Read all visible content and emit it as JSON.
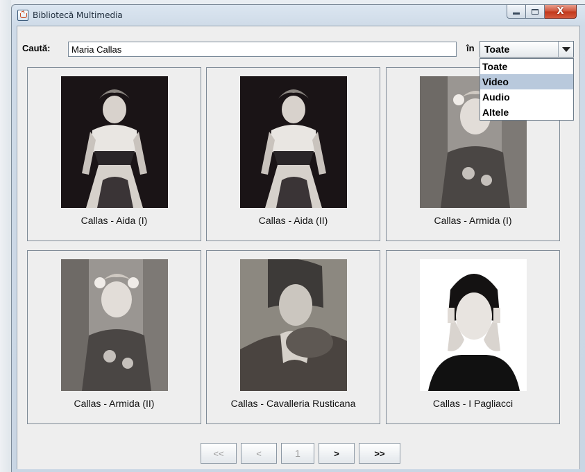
{
  "window": {
    "title": "Bibliotecă Multimedia",
    "close_glyph": "X"
  },
  "search": {
    "label": "Caută:",
    "value": "Maria Callas",
    "in_label": "în"
  },
  "filter": {
    "selected": "Toate",
    "options": [
      "Toate",
      "Video",
      "Audio",
      "Altele"
    ],
    "highlighted_option": "Video"
  },
  "results": [
    {
      "caption": "Callas - Aida (I)",
      "image": "portrait-opera-costume-photo"
    },
    {
      "caption": "Callas - Aida (II)",
      "image": "portrait-opera-costume-photo"
    },
    {
      "caption": "Callas - Armida (I)",
      "image": "portrait-flower-crown-photo"
    },
    {
      "caption": "Callas - Armida (II)",
      "image": "portrait-flower-crown-photo"
    },
    {
      "caption": "Callas - Cavalleria Rusticana",
      "image": "portrait-fur-stole-photo"
    },
    {
      "caption": "Callas - I Pagliacci",
      "image": "portrait-hands-on-face-photo"
    }
  ],
  "pager": {
    "first": "<<",
    "prev": "<",
    "page": "1",
    "next": ">",
    "last": ">>"
  },
  "colors": {
    "panel_bg": "#eeeeee",
    "selection": "#b9c9dc",
    "close_button": "#c2371b"
  }
}
